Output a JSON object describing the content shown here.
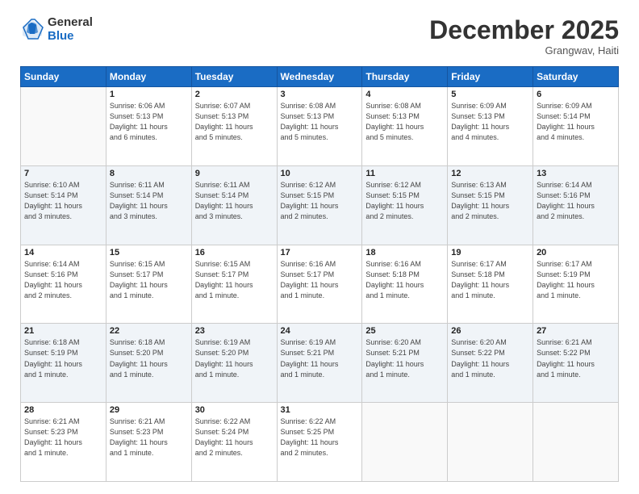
{
  "logo": {
    "general": "General",
    "blue": "Blue"
  },
  "title": "December 2025",
  "subtitle": "Grangwav, Haiti",
  "header_days": [
    "Sunday",
    "Monday",
    "Tuesday",
    "Wednesday",
    "Thursday",
    "Friday",
    "Saturday"
  ],
  "weeks": [
    [
      {
        "day": "",
        "info": ""
      },
      {
        "day": "1",
        "info": "Sunrise: 6:06 AM\nSunset: 5:13 PM\nDaylight: 11 hours\nand 6 minutes."
      },
      {
        "day": "2",
        "info": "Sunrise: 6:07 AM\nSunset: 5:13 PM\nDaylight: 11 hours\nand 5 minutes."
      },
      {
        "day": "3",
        "info": "Sunrise: 6:08 AM\nSunset: 5:13 PM\nDaylight: 11 hours\nand 5 minutes."
      },
      {
        "day": "4",
        "info": "Sunrise: 6:08 AM\nSunset: 5:13 PM\nDaylight: 11 hours\nand 5 minutes."
      },
      {
        "day": "5",
        "info": "Sunrise: 6:09 AM\nSunset: 5:13 PM\nDaylight: 11 hours\nand 4 minutes."
      },
      {
        "day": "6",
        "info": "Sunrise: 6:09 AM\nSunset: 5:14 PM\nDaylight: 11 hours\nand 4 minutes."
      }
    ],
    [
      {
        "day": "7",
        "info": "Sunrise: 6:10 AM\nSunset: 5:14 PM\nDaylight: 11 hours\nand 3 minutes."
      },
      {
        "day": "8",
        "info": "Sunrise: 6:11 AM\nSunset: 5:14 PM\nDaylight: 11 hours\nand 3 minutes."
      },
      {
        "day": "9",
        "info": "Sunrise: 6:11 AM\nSunset: 5:14 PM\nDaylight: 11 hours\nand 3 minutes."
      },
      {
        "day": "10",
        "info": "Sunrise: 6:12 AM\nSunset: 5:15 PM\nDaylight: 11 hours\nand 2 minutes."
      },
      {
        "day": "11",
        "info": "Sunrise: 6:12 AM\nSunset: 5:15 PM\nDaylight: 11 hours\nand 2 minutes."
      },
      {
        "day": "12",
        "info": "Sunrise: 6:13 AM\nSunset: 5:15 PM\nDaylight: 11 hours\nand 2 minutes."
      },
      {
        "day": "13",
        "info": "Sunrise: 6:14 AM\nSunset: 5:16 PM\nDaylight: 11 hours\nand 2 minutes."
      }
    ],
    [
      {
        "day": "14",
        "info": "Sunrise: 6:14 AM\nSunset: 5:16 PM\nDaylight: 11 hours\nand 2 minutes."
      },
      {
        "day": "15",
        "info": "Sunrise: 6:15 AM\nSunset: 5:17 PM\nDaylight: 11 hours\nand 1 minute."
      },
      {
        "day": "16",
        "info": "Sunrise: 6:15 AM\nSunset: 5:17 PM\nDaylight: 11 hours\nand 1 minute."
      },
      {
        "day": "17",
        "info": "Sunrise: 6:16 AM\nSunset: 5:17 PM\nDaylight: 11 hours\nand 1 minute."
      },
      {
        "day": "18",
        "info": "Sunrise: 6:16 AM\nSunset: 5:18 PM\nDaylight: 11 hours\nand 1 minute."
      },
      {
        "day": "19",
        "info": "Sunrise: 6:17 AM\nSunset: 5:18 PM\nDaylight: 11 hours\nand 1 minute."
      },
      {
        "day": "20",
        "info": "Sunrise: 6:17 AM\nSunset: 5:19 PM\nDaylight: 11 hours\nand 1 minute."
      }
    ],
    [
      {
        "day": "21",
        "info": "Sunrise: 6:18 AM\nSunset: 5:19 PM\nDaylight: 11 hours\nand 1 minute."
      },
      {
        "day": "22",
        "info": "Sunrise: 6:18 AM\nSunset: 5:20 PM\nDaylight: 11 hours\nand 1 minute."
      },
      {
        "day": "23",
        "info": "Sunrise: 6:19 AM\nSunset: 5:20 PM\nDaylight: 11 hours\nand 1 minute."
      },
      {
        "day": "24",
        "info": "Sunrise: 6:19 AM\nSunset: 5:21 PM\nDaylight: 11 hours\nand 1 minute."
      },
      {
        "day": "25",
        "info": "Sunrise: 6:20 AM\nSunset: 5:21 PM\nDaylight: 11 hours\nand 1 minute."
      },
      {
        "day": "26",
        "info": "Sunrise: 6:20 AM\nSunset: 5:22 PM\nDaylight: 11 hours\nand 1 minute."
      },
      {
        "day": "27",
        "info": "Sunrise: 6:21 AM\nSunset: 5:22 PM\nDaylight: 11 hours\nand 1 minute."
      }
    ],
    [
      {
        "day": "28",
        "info": "Sunrise: 6:21 AM\nSunset: 5:23 PM\nDaylight: 11 hours\nand 1 minute."
      },
      {
        "day": "29",
        "info": "Sunrise: 6:21 AM\nSunset: 5:23 PM\nDaylight: 11 hours\nand 1 minute."
      },
      {
        "day": "30",
        "info": "Sunrise: 6:22 AM\nSunset: 5:24 PM\nDaylight: 11 hours\nand 2 minutes."
      },
      {
        "day": "31",
        "info": "Sunrise: 6:22 AM\nSunset: 5:25 PM\nDaylight: 11 hours\nand 2 minutes."
      },
      {
        "day": "",
        "info": ""
      },
      {
        "day": "",
        "info": ""
      },
      {
        "day": "",
        "info": ""
      }
    ]
  ]
}
